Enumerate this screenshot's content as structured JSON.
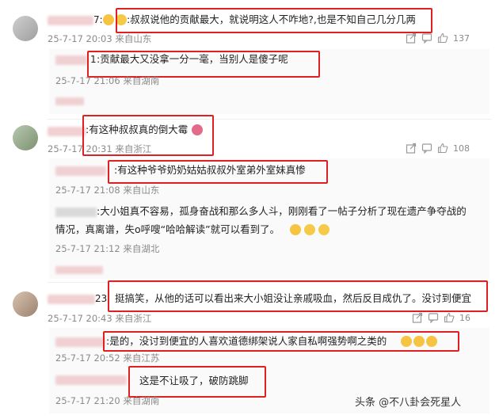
{
  "threads": [
    {
      "comment": {
        "text": ":叔叔说他的贡献最大，就说明这人不咋地?,也是不知自己几分几两",
        "name_suffix": "7:",
        "meta": "25-7-17 20:03 来自山东",
        "like_count": "137"
      },
      "replies": [
        {
          "text": ":贡献最大又没拿一分一毫，当别人是傻子呢",
          "name_suffix": "1",
          "meta": "25-7-17 21:06 来自湖南"
        }
      ]
    },
    {
      "comment": {
        "text": ":有这种叔叔真的倒大霉",
        "meta": "25-7-17 20:31 来自浙江",
        "like_count": "108"
      },
      "replies": [
        {
          "text": ":有这种爷爷奶奶姑姑叔叔外室弟外室妹真惨",
          "meta": "25-7-17 21:08 来自山东"
        },
        {
          "text_line1": ":大小姐真不容易，孤身奋战和那么多人斗，刚刚看了一帖子分析了现在遗产争夺战的",
          "text_line2": "情况，真离谱，失o呼嗖“哈哈解读”就可以看到了。",
          "meta": "25-7-17 21:12 来自湖北"
        }
      ]
    },
    {
      "comment": {
        "text": "挺搞笑，从他的话可以看出来大小姐没让亲戚吸血，然后反目成仇了。没讨到便宜",
        "name_suffix": "23:",
        "meta": "25-7-17 20:43 来自浙江",
        "like_count": "16"
      },
      "replies": [
        {
          "text": ":是的，没讨到便宜的人喜欢道德绑架说人家自私啊强势啊之类的",
          "meta": "25-7-17 20:52 来自江苏"
        },
        {
          "text": "这是不让吸了，破防跳脚",
          "meta": "25-7-17 21:20 来自湖南"
        }
      ]
    }
  ],
  "watermark": "头条 @不八卦会死星人",
  "icons": {
    "share": "share-icon",
    "comment": "comment-icon",
    "like": "thumbs-up-icon"
  },
  "colors": {
    "highlight_box": "#e02020",
    "meta": "#8a8a8a"
  }
}
